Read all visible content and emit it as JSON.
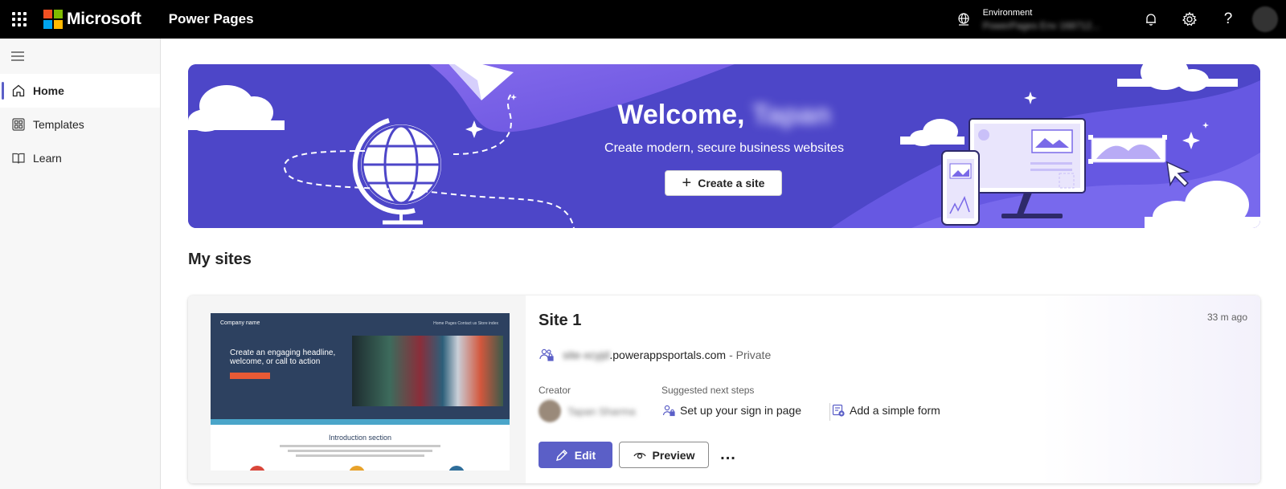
{
  "topbar": {
    "brand": "Microsoft",
    "app_name": "Power Pages",
    "environment_label": "Environment",
    "environment_value": "PowerPages Env 168712..."
  },
  "sidebar": {
    "items": [
      {
        "label": "Home",
        "icon": "home-icon",
        "active": true
      },
      {
        "label": "Templates",
        "icon": "templates-icon",
        "active": false
      },
      {
        "label": "Learn",
        "icon": "book-icon",
        "active": false
      }
    ]
  },
  "hero": {
    "title": "Welcome,",
    "user_name": "Tapan",
    "subtitle": "Create modern, secure business websites",
    "create_button": "Create a site"
  },
  "my_sites": {
    "title": "My sites",
    "sites": [
      {
        "name": "Site 1",
        "timestamp": "33 m ago",
        "url_prefix": "site-xcyjd",
        "url_domain": ".powerappsportals.com",
        "visibility": "- Private",
        "creator_label": "Creator",
        "creator_name": "Tapan Sharma",
        "next_steps_label": "Suggested next steps",
        "steps": [
          "Set up your sign in page",
          "Add a simple form"
        ],
        "edit_label": "Edit",
        "preview_label": "Preview",
        "more_label": "...",
        "thumbnail": {
          "company": "Company name",
          "nav": "Home   Pages   Contact us      Store index",
          "headline": "Create an engaging headline, welcome, or call to action",
          "intro": "Introduction section"
        }
      }
    ]
  },
  "colors": {
    "accent": "#5b5fc7",
    "hero_bg": "#4d46c8",
    "topbar_bg": "#000000"
  }
}
